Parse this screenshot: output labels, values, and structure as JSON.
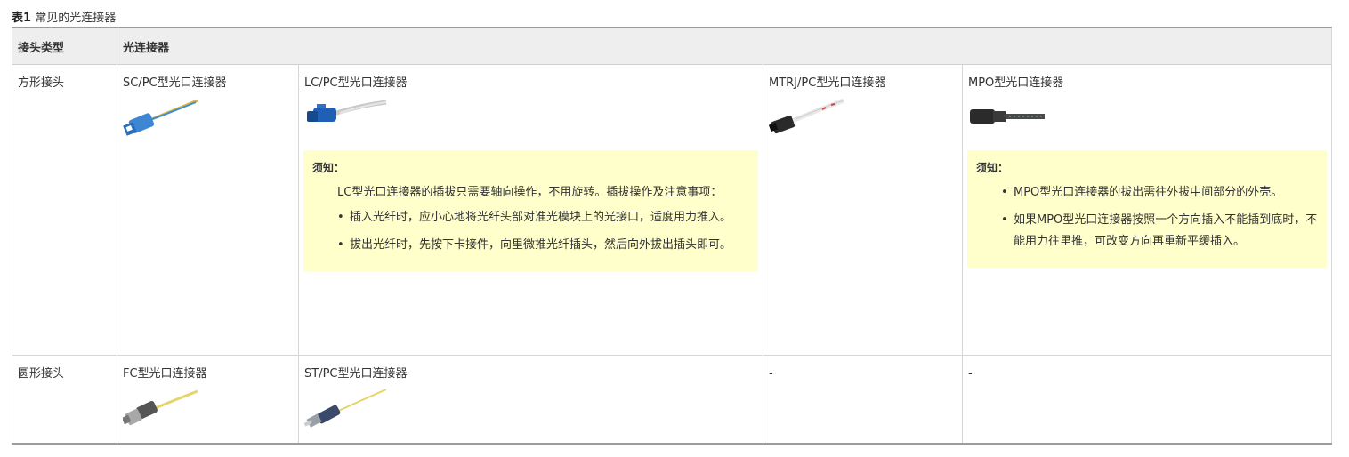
{
  "caption": {
    "num": "表1",
    "text": "常见的光连接器"
  },
  "header": {
    "col1": "接头类型",
    "col2": "光连接器"
  },
  "rows": [
    {
      "type": "方形接头",
      "c1": "SC/PC型光口连接器",
      "c2": "LC/PC型光口连接器",
      "c3": "MTRJ/PC型光口连接器",
      "c4": "MPO型光口连接器",
      "lc_notice": {
        "title": "须知：",
        "intro": "LC型光口连接器的插拔只需要轴向操作，不用旋转。插拔操作及注意事项：",
        "items": [
          "插入光纤时，应小心地将光纤头部对准光模块上的光接口，适度用力推入。",
          "拔出光纤时，先按下卡接件，向里微推光纤插头，然后向外拔出插头即可。"
        ]
      },
      "mpo_notice": {
        "title": "须知：",
        "items": [
          "MPO型光口连接器的拔出需往外拔中间部分的外壳。",
          "如果MPO型光口连接器按照一个方向插入不能插到底时，不能用力往里推，可改变方向再重新平缓插入。"
        ]
      }
    },
    {
      "type": "圆形接头",
      "c1": "FC型光口连接器",
      "c2": "ST/PC型光口连接器",
      "c3": "-",
      "c4": "-"
    }
  ]
}
